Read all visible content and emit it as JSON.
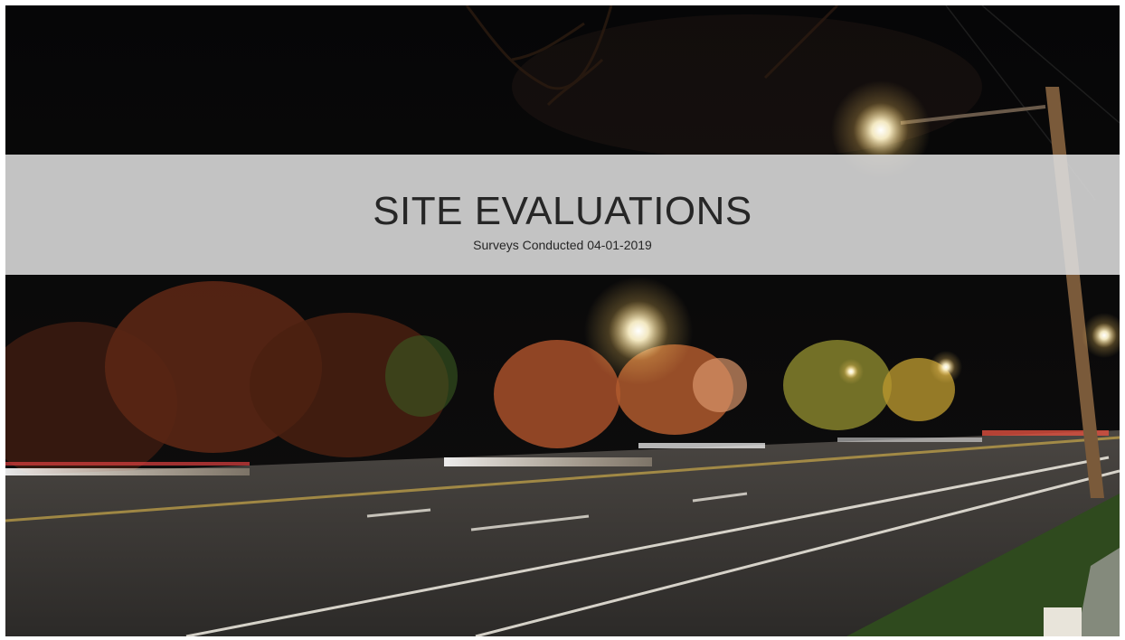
{
  "slide": {
    "title": "SITE EVALUATIONS",
    "subtitle": "Surveys Conducted 04-01-2019"
  },
  "background": {
    "scene": "night-street-long-exposure",
    "colors": {
      "sky": "#050506",
      "road": "#3a3835",
      "lane_line": "#e8e4da",
      "yellow_line": "#c9a84a",
      "tree_warm": "#8a3a1c",
      "tree_orange": "#c06a2a",
      "grass": "#2f4a1e",
      "streetlight": "#fff6d8",
      "pole": "#7a5a3a"
    }
  },
  "band": {
    "color": "#dddddd"
  }
}
